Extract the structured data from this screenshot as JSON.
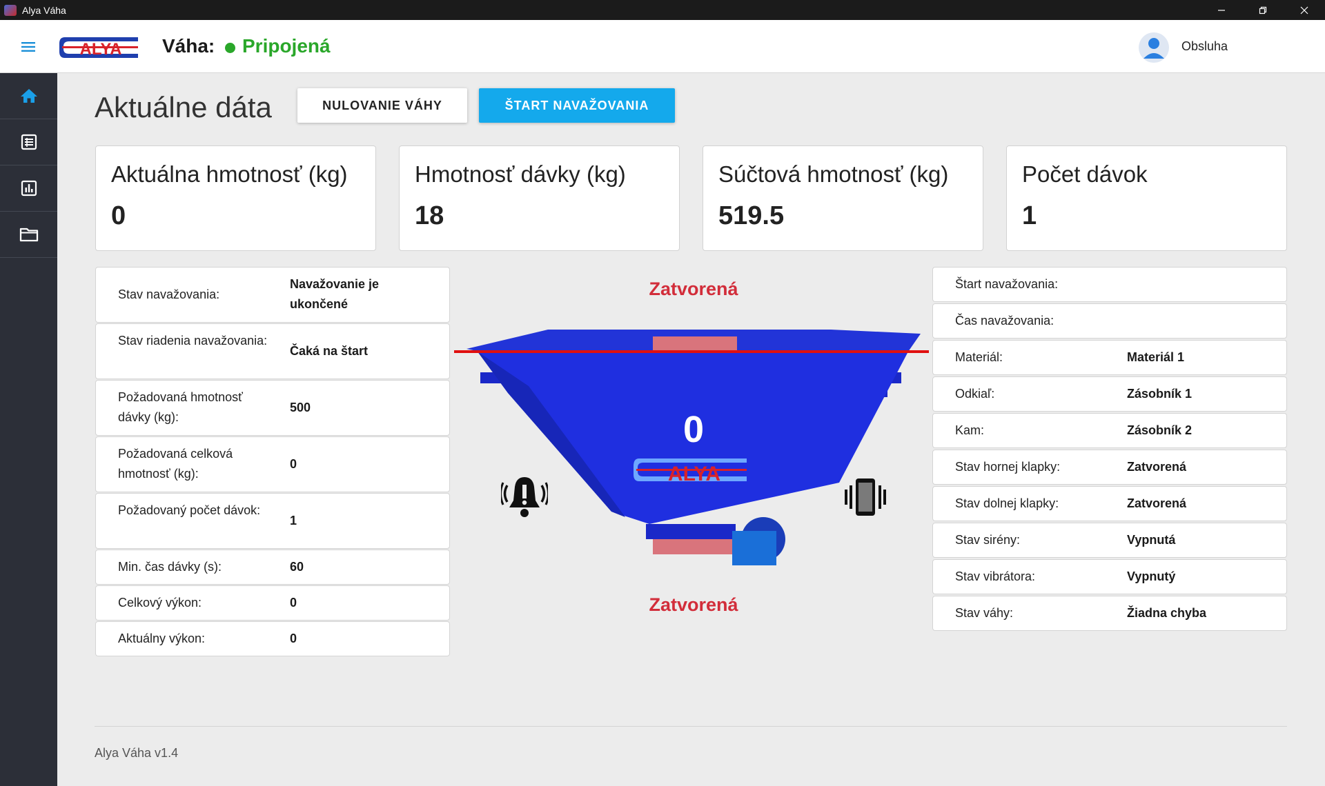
{
  "window": {
    "title": "Alya Váha"
  },
  "header": {
    "logo_text": "ALYA",
    "scale_label": "Váha:",
    "connection_status": "Pripojená",
    "user_name": "Obsluha"
  },
  "sidebar": {
    "items": [
      {
        "icon": "home-icon",
        "active": true
      },
      {
        "icon": "table-icon",
        "active": false
      },
      {
        "icon": "chart-icon",
        "active": false
      },
      {
        "icon": "folder-icon",
        "active": false
      }
    ]
  },
  "page": {
    "title": "Aktuálne dáta",
    "zero_button": "NULOVANIE VÁHY",
    "start_button": "ŠTART NAVAŽOVANIA"
  },
  "stats": [
    {
      "label": "Aktuálna hmotnosť (kg)",
      "value": "0"
    },
    {
      "label": "Hmotnosť dávky (kg)",
      "value": "18"
    },
    {
      "label": "Súčtová hmotnosť (kg)",
      "value": "519.5"
    },
    {
      "label": "Počet dávok",
      "value": "1"
    }
  ],
  "left_table": [
    {
      "key": "Stav navažovania:",
      "value": "Navažovanie je ukončené"
    },
    {
      "key": "Stav riadenia navažovania:",
      "value": "Čaká na štart"
    },
    {
      "key": "Požadovaná hmotnosť dávky (kg):",
      "value": "500"
    },
    {
      "key": "Požadovaná celková hmotnosť (kg):",
      "value": "0"
    },
    {
      "key": "Požadovaný počet dávok:",
      "value": "1"
    },
    {
      "key": "Min. čas dávky (s):",
      "value": "60"
    },
    {
      "key": "Celkový výkon:",
      "value": "0"
    },
    {
      "key": "Aktuálny výkon:",
      "value": "0"
    }
  ],
  "hopper": {
    "top_flap_status": "Zatvorená",
    "bottom_flap_status": "Zatvorená",
    "weight": "0",
    "logo_text": "ALYA",
    "colors": {
      "body": "#1f2fe0",
      "flap": "#d9747c",
      "level_line": "#e01010"
    }
  },
  "right_table": [
    {
      "key": "Štart navažovania:",
      "value": ""
    },
    {
      "key": "Čas navažovania:",
      "value": ""
    },
    {
      "key": "Materiál:",
      "value": "Materiál 1"
    },
    {
      "key": "Odkiaľ:",
      "value": "Zásobník 1"
    },
    {
      "key": "Kam:",
      "value": "Zásobník 2"
    },
    {
      "key": "Stav hornej klapky:",
      "value": "Zatvorená"
    },
    {
      "key": "Stav dolnej klapky:",
      "value": "Zatvorená"
    },
    {
      "key": "Stav sirény:",
      "value": "Vypnutá"
    },
    {
      "key": "Stav vibrátora:",
      "value": "Vypnutý"
    },
    {
      "key": "Stav váhy:",
      "value": "Žiadna chyba"
    }
  ],
  "footer": {
    "version": "Alya Váha v1.4"
  },
  "theme": {
    "accent": "#14a9ec",
    "connected": "#2aa72a",
    "alert": "#d22d3a",
    "sidebar": "#2c2f38"
  }
}
